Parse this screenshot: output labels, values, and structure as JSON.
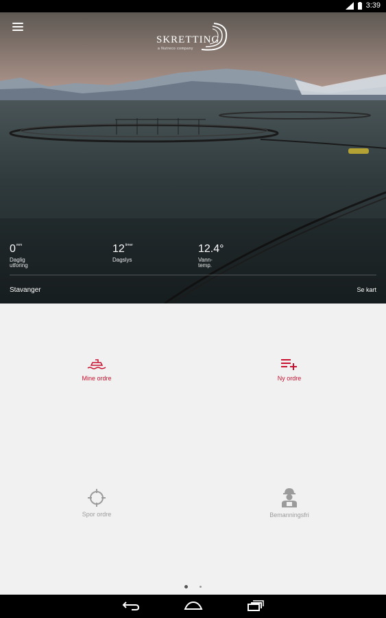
{
  "status_bar": {
    "time": "3:39",
    "icons": [
      "signal-icon",
      "battery-icon"
    ]
  },
  "header": {
    "menu_icon": "hamburger-menu-icon",
    "brand": "SKRETTING",
    "brand_sub": "a Nutreco company"
  },
  "weather": [
    {
      "value": "0",
      "unit": "mm",
      "label_lines": [
        "Daglig",
        "utforing"
      ]
    },
    {
      "value": "12",
      "unit": "timer",
      "label_lines": [
        "Dagslys"
      ]
    },
    {
      "value": "12.4°",
      "unit": "",
      "label_lines": [
        "Vann-",
        "temp."
      ]
    }
  ],
  "location": "Stavanger",
  "see_map": "Se kart",
  "tiles": [
    {
      "label": "Mine ordre",
      "icon": "ship-icon",
      "color": "#c8102e"
    },
    {
      "label": "Ny ordre",
      "icon": "add-list-icon",
      "color": "#c8102e"
    },
    {
      "label": "Spor ordre",
      "icon": "crosshair-icon",
      "color": "#9b9b9b"
    },
    {
      "label": "Bemanningsfri",
      "icon": "worker-icon",
      "color": "#9b9b9b"
    }
  ],
  "pagination": {
    "pages": 2,
    "current": 1
  },
  "nav": [
    "back-icon",
    "home-icon",
    "recents-icon"
  ]
}
